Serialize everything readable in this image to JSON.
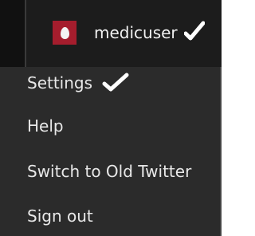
{
  "user": {
    "username": "medicuser",
    "avatar_color": "#a51d2d"
  },
  "menu": {
    "items": [
      {
        "label": "Settings",
        "checked": true
      },
      {
        "label": "Help"
      },
      {
        "label": "Switch to Old Twitter"
      },
      {
        "label": "Sign out"
      }
    ]
  },
  "icons": {
    "checkmark": "checkmark-icon",
    "avatar": "egg-avatar-icon"
  }
}
